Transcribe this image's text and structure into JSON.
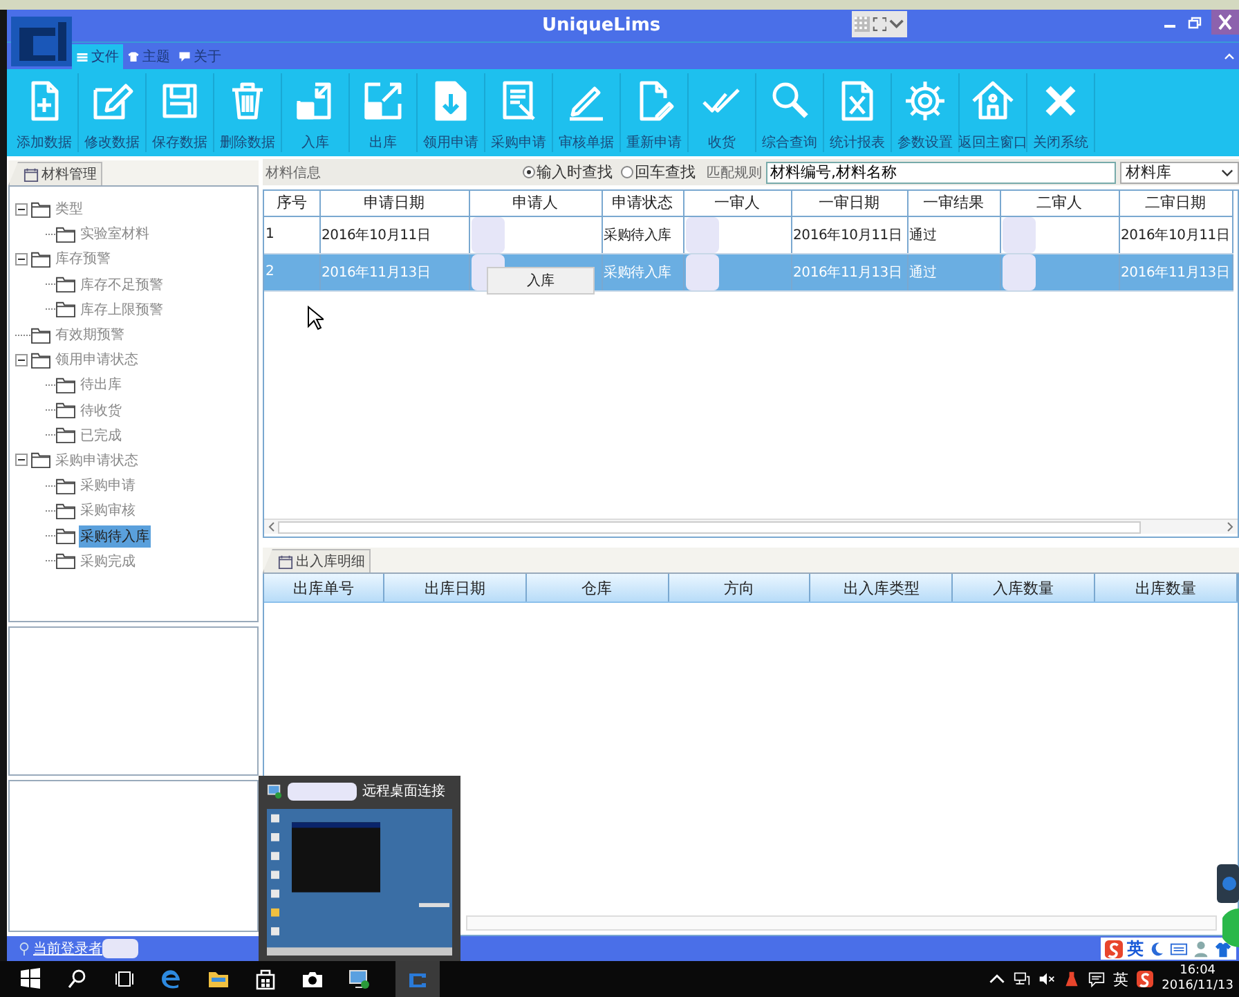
{
  "title_bar": {
    "title": "UniqueLims"
  },
  "menu_tabs": [
    {
      "label": "文件",
      "selected": true
    },
    {
      "label": "主题",
      "selected": false
    },
    {
      "label": "关于",
      "selected": false
    }
  ],
  "toolbar": [
    {
      "label": "添加数据",
      "kind": "add"
    },
    {
      "label": "修改数据",
      "kind": "edit"
    },
    {
      "label": "保存数据",
      "kind": "save"
    },
    {
      "label": "删除数据",
      "kind": "delete"
    },
    {
      "label": "入库",
      "kind": "in"
    },
    {
      "label": "出库",
      "kind": "out"
    },
    {
      "label": "领用申请",
      "kind": "receive"
    },
    {
      "label": "采购申请",
      "kind": "purchase"
    },
    {
      "label": "审核单据",
      "kind": "audit"
    },
    {
      "label": "重新申请",
      "kind": "reapply"
    },
    {
      "label": "收货",
      "kind": "check"
    },
    {
      "label": "综合查询",
      "kind": "search"
    },
    {
      "label": "统计报表",
      "kind": "excel"
    },
    {
      "label": "参数设置",
      "kind": "gear"
    },
    {
      "label": "返回主窗口",
      "kind": "home"
    },
    {
      "label": "关闭系统",
      "kind": "close"
    }
  ],
  "left_panel": {
    "tab": "材料管理",
    "tree": [
      {
        "label": "类型",
        "selected": false,
        "expanded": true,
        "children": [
          {
            "label": "实验室材料",
            "selected": false
          }
        ]
      },
      {
        "label": "库存预警",
        "selected": false,
        "expanded": true,
        "children": [
          {
            "label": "库存不足预警",
            "selected": false
          },
          {
            "label": "库存上限预警",
            "selected": false
          }
        ]
      },
      {
        "label": "有效期预警",
        "selected": false
      },
      {
        "label": "领用申请状态",
        "selected": false,
        "expanded": true,
        "children": [
          {
            "label": "待出库",
            "selected": false
          },
          {
            "label": "待收货",
            "selected": false
          },
          {
            "label": "已完成",
            "selected": false
          }
        ]
      },
      {
        "label": "采购申请状态",
        "selected": false,
        "expanded": true,
        "children": [
          {
            "label": "采购申请",
            "selected": false
          },
          {
            "label": "采购审核",
            "selected": false
          },
          {
            "label": "采购待入库",
            "selected": true
          },
          {
            "label": "采购完成",
            "selected": false
          }
        ]
      }
    ]
  },
  "search_bar": {
    "title": "材料信息",
    "modes": [
      {
        "label": "输入时查找",
        "selected": true
      },
      {
        "label": "回车查找",
        "selected": false
      }
    ],
    "rule_label": "匹配规则",
    "rule_value": "材料编号,材料名称",
    "library": "材料库"
  },
  "table": {
    "columns": [
      "序号",
      "申请日期",
      "申请人",
      "申请状态",
      "一审人",
      "一审日期",
      "一审结果",
      "二审人",
      "二审日期"
    ],
    "rows": [
      {
        "selected": false,
        "cells": [
          "1",
          "2016年10月11日",
          null,
          "采购待入库",
          null,
          "2016年10月11日",
          "通过",
          null,
          "2016年10月11日"
        ]
      },
      {
        "selected": true,
        "cells": [
          "2",
          "2016年11月13日",
          null,
          "采购待入库",
          null,
          "2016年11月13日",
          "通过",
          null,
          "2016年11月13日"
        ]
      }
    ]
  },
  "context_menu": {
    "items": [
      "入库"
    ]
  },
  "detail_panel": {
    "tab": "出入库明细",
    "columns": [
      "出库单号",
      "出库日期",
      "仓库",
      "方向",
      "出入库类型",
      "入库数量",
      "出库数量"
    ]
  },
  "status_bar": {
    "label": "当前登录者",
    "ime_lang": "英"
  },
  "taskbar_preview": {
    "title": "远程桌面连接"
  },
  "tray": {
    "lang": "英",
    "time": "16:04",
    "date": "2016/11/13"
  }
}
